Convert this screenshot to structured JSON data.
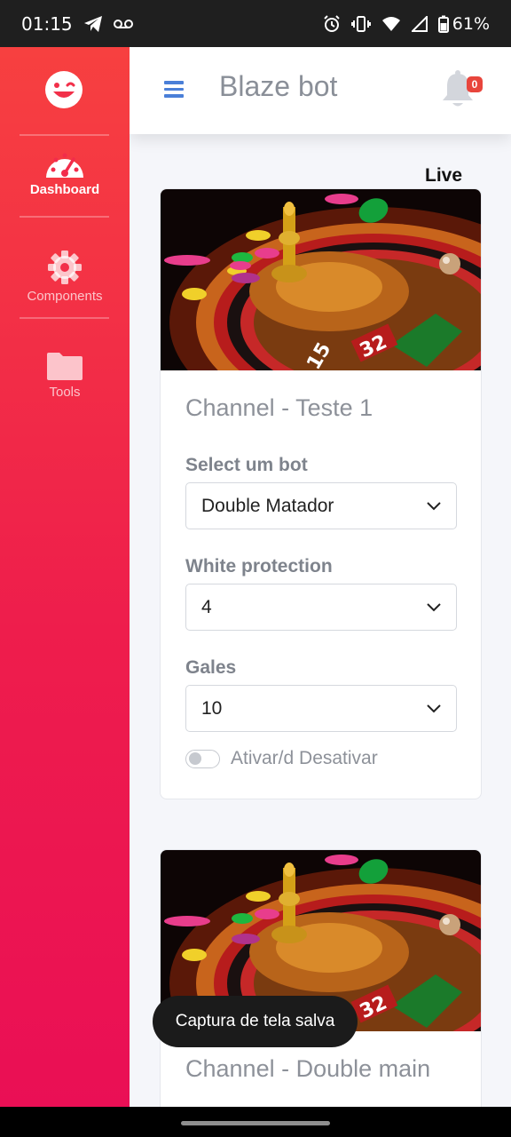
{
  "status_bar": {
    "time": "01:15",
    "battery": "61%",
    "left_icons": [
      "telegram-icon",
      "voicemail-icon"
    ],
    "right_icons": [
      "alarm-icon",
      "vibrate-icon",
      "wifi-icon",
      "signal-icon",
      "battery-icon"
    ]
  },
  "sidebar": {
    "logo_icon": "smiley-logo-icon",
    "items": [
      {
        "label": "Dashboard",
        "icon": "speedometer-icon",
        "active": true
      },
      {
        "label": "Components",
        "icon": "gear-icon",
        "active": false
      },
      {
        "label": "Tools",
        "icon": "folder-icon",
        "active": false
      }
    ]
  },
  "header": {
    "title": "Blaze bot",
    "notification_count": "0",
    "menu_icon": "hamburger-icon",
    "bell_icon": "bell-icon"
  },
  "live_label": "Live",
  "cards": [
    {
      "image": "roulette-wheel-image",
      "title": "Channel - Teste 1",
      "fields": [
        {
          "label": "Select um bot",
          "value": "Double Matador"
        },
        {
          "label": "White protection",
          "value": "4"
        },
        {
          "label": "Gales",
          "value": "10"
        }
      ],
      "toggle_label": "Ativar/d Desativar",
      "toggle_on": false
    },
    {
      "image": "roulette-wheel-image",
      "title": "Channel - Double main"
    }
  ],
  "toast": "Captura de tela salva",
  "colors": {
    "sidebar_top": "#f74040",
    "sidebar_bottom": "#ea0f55",
    "menu_blue": "#4a7fd8",
    "badge_red": "#e8453c"
  }
}
